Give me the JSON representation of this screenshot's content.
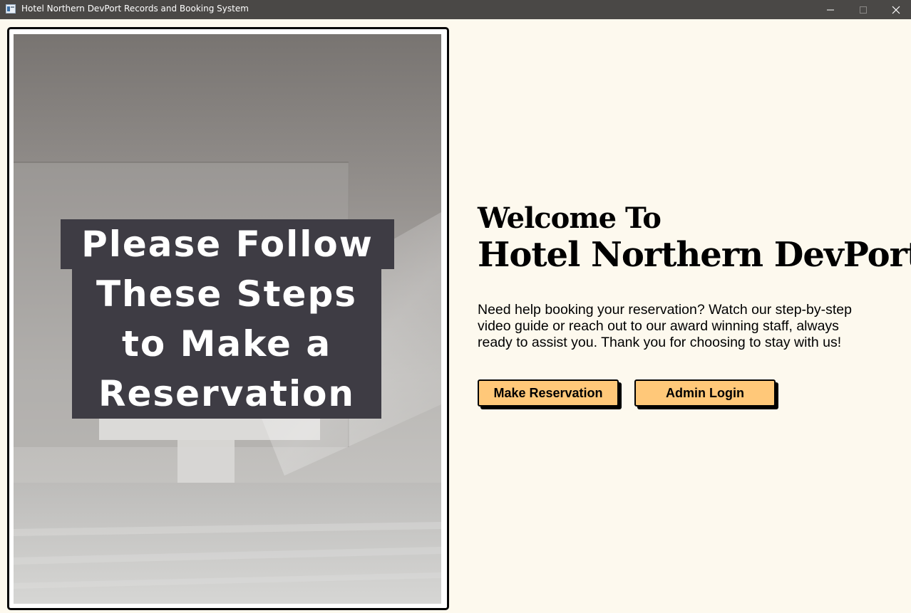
{
  "window": {
    "title": "Hotel Northern DevPort Records and Booking System",
    "icon": "app-window-icon",
    "controls": [
      "minimize-icon",
      "maximize-icon",
      "close-icon"
    ]
  },
  "poster": {
    "lines": [
      "Please Follow",
      "These Steps",
      "to Make a",
      "Reservation"
    ]
  },
  "welcome": {
    "line1": "Welcome To",
    "line2": "Hotel Northern DevPort"
  },
  "description": "Need help booking your reservation? Watch our step-by-step video guide or reach out to our award winning staff, always ready to assist you. Thank you for choosing to stay with us!",
  "buttons": {
    "make_reservation": "Make Reservation",
    "admin_login": "Admin Login"
  },
  "colors": {
    "background": "#fdf9ee",
    "titlebar": "#4a4846",
    "button": "#ffc879",
    "banner": "#3e3c44"
  }
}
